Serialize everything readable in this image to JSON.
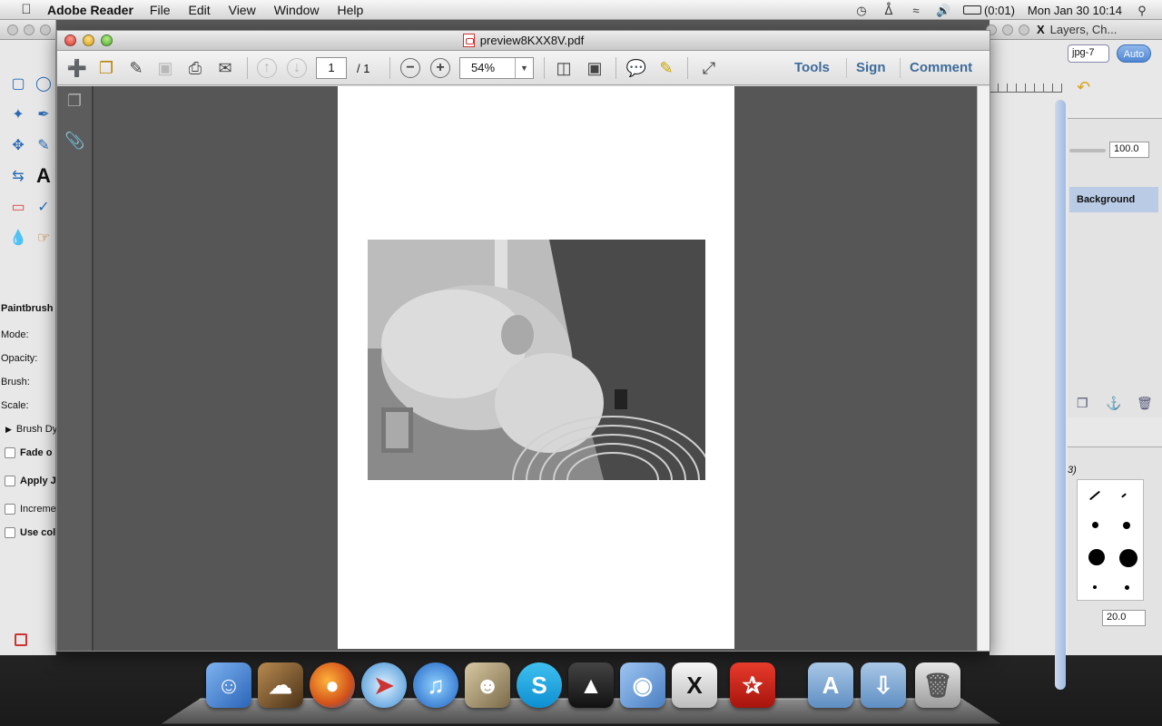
{
  "menubar": {
    "app_name": "Adobe Reader",
    "menus": [
      "File",
      "Edit",
      "View",
      "Window",
      "Help"
    ],
    "battery": "(0:01)",
    "clock": "Mon Jan 30  10:14"
  },
  "toolbox": {
    "options_title": "Paintbrush",
    "mode_label": "Mode:",
    "opacity_label": "Opacity:",
    "brush_label": "Brush:",
    "scale_label": "Scale:",
    "brush_dynamics": "Brush Dy",
    "fade_label": "Fade o",
    "apply_label": "Apply J",
    "incremental_label": "Increme",
    "use_color_label": "Use col"
  },
  "layers_panel": {
    "title": "Layers, Ch...",
    "image_select": "jpg-7",
    "auto_button": "Auto",
    "opacity_value": "100.0",
    "layer_name": "Background",
    "brush_count": "3)",
    "spacing_value": "20.0"
  },
  "reader": {
    "title": "preview8KXX8V.pdf",
    "page_current": "1",
    "page_total": "/   1",
    "zoom": "54%",
    "links": {
      "tools": "Tools",
      "sign": "Sign",
      "comment": "Comment"
    }
  },
  "colors": {
    "link_blue": "#3e6b9a",
    "canvas_gray": "#565656",
    "selection_blue": "#b9cbe5"
  }
}
